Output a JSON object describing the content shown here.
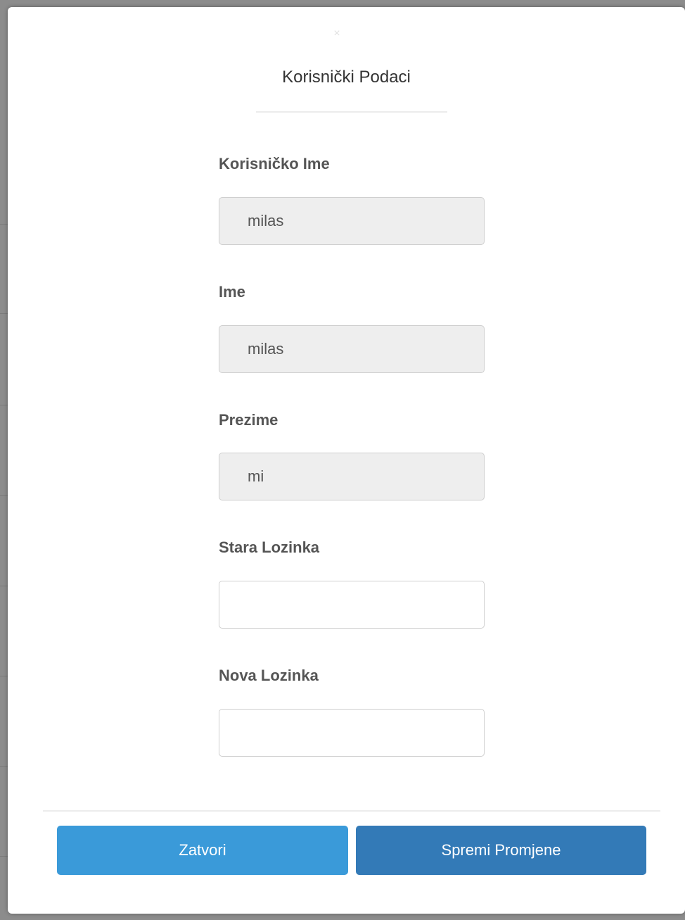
{
  "modal": {
    "close_glyph": "×",
    "title": "Korisnički Podaci"
  },
  "fields": {
    "username": {
      "label": "Korisničko Ime",
      "value": "milas"
    },
    "first_name": {
      "label": "Ime",
      "value": "milas"
    },
    "last_name": {
      "label": "Prezime",
      "value": "mi"
    },
    "old_password": {
      "label": "Stara Lozinka",
      "value": ""
    },
    "new_password": {
      "label": "Nova Lozinka",
      "value": ""
    }
  },
  "buttons": {
    "close_label": "Zatvori",
    "save_label": "Spremi Promjene"
  },
  "colors": {
    "close_button": "#3a9ad9",
    "save_button": "#337ab7",
    "readonly_field": "#eeeeee"
  }
}
